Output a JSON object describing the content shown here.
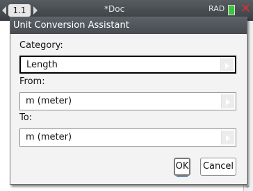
{
  "app": {
    "tab_label": "1.1",
    "doc_title": "*Doc",
    "mode": "RAD"
  },
  "dialog": {
    "title": "Unit Conversion Assistant",
    "category": {
      "label": "Category:",
      "value": "Length"
    },
    "from": {
      "label": "From:",
      "value": "m (meter)"
    },
    "to": {
      "label": "To:",
      "value": "m (meter)"
    },
    "ok_label": "OK",
    "cancel_label": "Cancel"
  },
  "icons": {
    "close": "close-icon",
    "battery": "battery-icon",
    "dropdown": "chevron-right-icon"
  },
  "colors": {
    "titlebar": "#4f5358",
    "close": "#e03030",
    "battery": "#3fc23f"
  }
}
